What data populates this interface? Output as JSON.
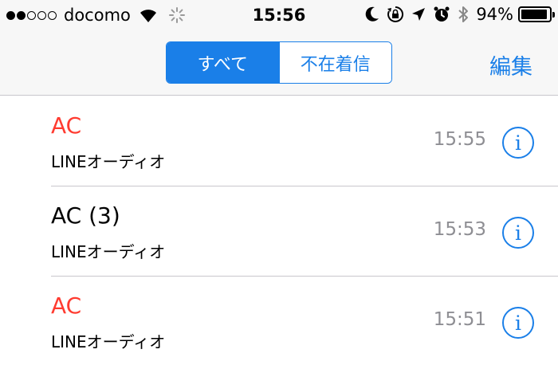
{
  "status_bar": {
    "carrier": "docomo",
    "time": "15:56",
    "battery_percent": "94%",
    "battery_level": 0.94,
    "icons": [
      "signal-dots-icon",
      "wifi-icon",
      "activity-spinner-icon",
      "moon-icon",
      "orientation-lock-icon",
      "location-arrow-icon",
      "alarm-icon",
      "bluetooth-icon",
      "battery-icon"
    ]
  },
  "nav": {
    "segments": [
      "すべて",
      "不在着信"
    ],
    "selected_segment": "すべて",
    "edit_label": "編集"
  },
  "calls": [
    {
      "name": "AC",
      "missed": true,
      "type": "LINEオーディオ",
      "time": "15:55"
    },
    {
      "name": "AC (3)",
      "missed": false,
      "type": "LINEオーディオ",
      "time": "15:53"
    },
    {
      "name": "AC",
      "missed": true,
      "type": "LINEオーディオ",
      "time": "15:51"
    }
  ],
  "colors": {
    "accent": "#1a7fe8",
    "missed": "#ff3b30",
    "secondary_text": "#8e8e93"
  }
}
